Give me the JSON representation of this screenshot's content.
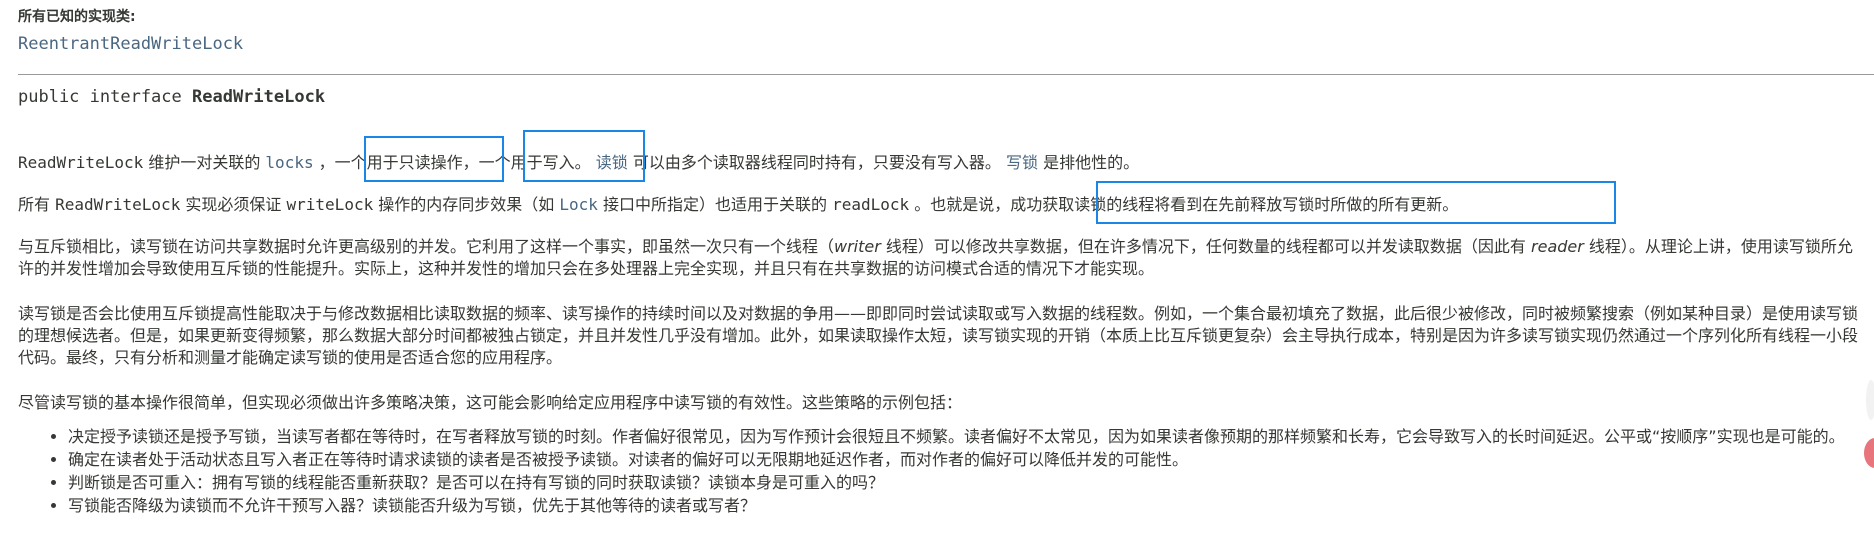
{
  "known_impl": {
    "title": "所有已知的实现类:",
    "link": "ReentrantReadWriteLock"
  },
  "declaration": {
    "prefix": "public interface ",
    "name": "ReadWriteLock"
  },
  "para1": {
    "t1": "ReadWriteLock",
    "t2": " 维护一对关联的 ",
    "t3": "locks",
    "t4": " ，一个用于只读操作，一个用于写入。 ",
    "t5": "读锁",
    "t6": " 可以由多个读取器线程同时持有，只要没有写入器。 ",
    "t7": "写锁",
    "t8": " 是排他性的。"
  },
  "para2": {
    "t1": "所有 ",
    "t2": "ReadWriteLock",
    "t3": " 实现必须保证 ",
    "t4": "writeLock",
    "t5": " 操作的内存同步效果（如 ",
    "t6": "Lock",
    "t7": " 接口中所指定）也适用于关联的 ",
    "t8": "readLock",
    "t9": " 。也就是说，成功获取读锁的线程将看到在先前释放写锁时所做的所有更新。"
  },
  "para3": {
    "t1": "与互斥锁相比，读写锁在访问共享数据时允许更高级别的并发。它利用了这样一个事实，即虽然一次只有一个线程（",
    "t2": "writer",
    "t3": " 线程）可以修改共享数据，但在许多情况下，任何数量的线程都可以并发读取数据（因此有 ",
    "t4": "reader",
    "t5": " 线程）。从理论上讲，使用读写锁所允许的并发性增加会导致使用互斥锁的性能提升。实际上，这种并发性的增加只会在多处理器上完全实现，并且只有在共享数据的访问模式合适的情况下才能实现。"
  },
  "para4": "读写锁是否会比使用互斥锁提高性能取决于与修改数据相比读取数据的频率、读写操作的持续时间以及对数据的争用——即即同时尝试读取或写入数据的线程数。例如，一个集合最初填充了数据，此后很少被修改，同时被频繁搜索（例如某种目录）是使用读写锁的理想候选者。但是，如果更新变得频繁，那么数据大部分时间都被独占锁定，并且并发性几乎没有增加。此外，如果读取操作太短，读写锁实现的开销（本质上比互斥锁更复杂）会主导执行成本，特别是因为许多读写锁实现仍然通过一个序列化所有线程一小段代码。最终，只有分析和测量才能确定读写锁的使用是否适合您的应用程序。",
  "para5": "尽管读写锁的基本操作很简单，但实现必须做出许多策略决策，这可能会影响给定应用程序中读写锁的有效性。这些策略的示例包括：",
  "strategies": [
    "决定授予读锁还是授予写锁，当读写者都在等待时，在写者释放写锁的时刻。作者偏好很常见，因为写作预计会很短且不频繁。读者偏好不太常见，因为如果读者像预期的那样频繁和长寿，它会导致写入的长时间延迟。公平或“按顺序”实现也是可能的。",
    "确定在读者处于活动状态且写入者正在等待时请求读锁的读者是否被授予读锁。对读者的偏好可以无限期地延迟作者，而对作者的偏好可以降低并发的可能性。",
    "判断锁是否可重入：拥有写锁的线程能否重新获取？是否可以在持有写锁的同时获取读锁？读锁本身是可重入的吗？",
    "写锁能否降级为读锁而不允许干预写入器？读锁能否升级为写锁，优先于其他等待的读者或写者？"
  ],
  "colors": {
    "text": "#353833",
    "link": "#4a6782",
    "highlight": "#1a87e6"
  }
}
